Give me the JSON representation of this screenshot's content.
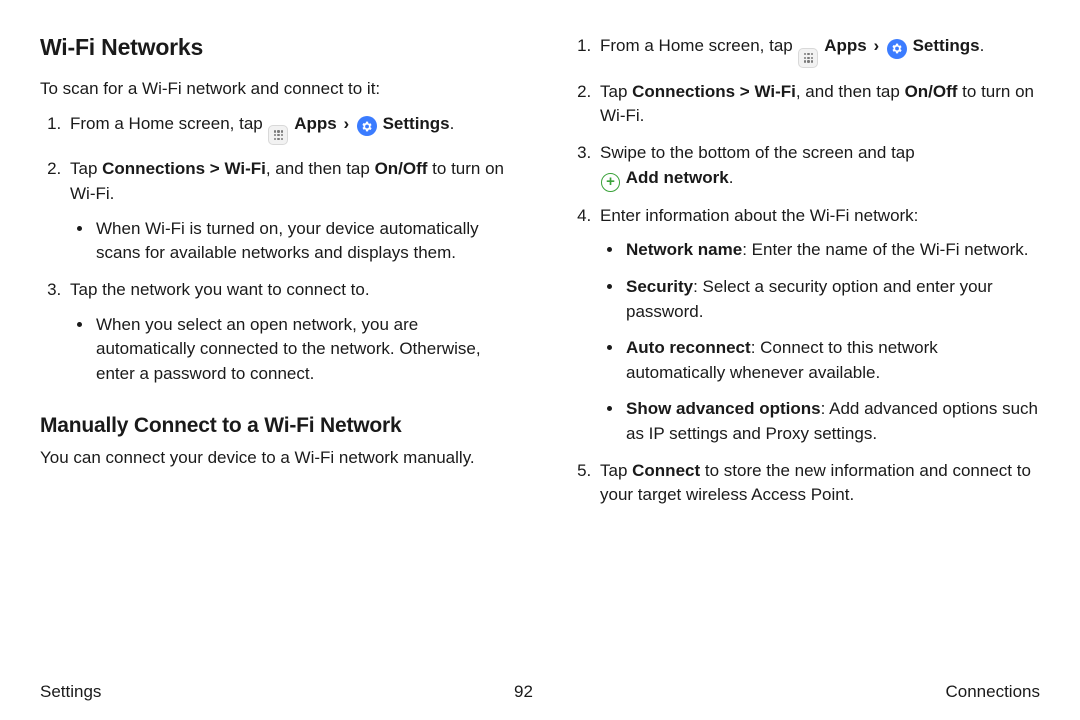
{
  "left": {
    "heading1": "Wi-Fi Networks",
    "lead1": "To scan for a Wi-Fi network and connect to it:",
    "step1_a": "From a Home screen, tap ",
    "apps_label": "Apps",
    "settings_label": "Settings",
    "period": ".",
    "step2_a": "Tap ",
    "step2_path": "Connections > Wi-Fi",
    "step2_b": ", and then tap ",
    "step2_onoff": "On/Off",
    "step2_c": " to turn on Wi-Fi.",
    "step2_bul": "When Wi-Fi is turned on, your device automatically scans for available networks and displays them.",
    "step3": "Tap the network you want to connect to.",
    "step3_bul": "When you select an open network, you are automatically connected to the network. Otherwise, enter a password to connect.",
    "heading2": "Manually Connect to a Wi-Fi Network",
    "lead2": "You can connect your device to a Wi-Fi network manually."
  },
  "right": {
    "step1_a": "From a Home screen, tap ",
    "apps_label": "Apps",
    "settings_label": "Settings",
    "period": ".",
    "step2_a": "Tap ",
    "step2_path": "Connections > Wi-Fi",
    "step2_b": ", and then tap ",
    "step2_onoff": "On/Off",
    "step2_c": " to turn on Wi-Fi.",
    "step3_a": "Swipe to the bottom of the screen and tap ",
    "addnet_label": "Add network",
    "step4": "Enter information about the Wi-Fi network:",
    "b_netname_t": "Network name",
    "b_netname_d": ": Enter the name of the Wi-Fi network.",
    "b_sec_t": "Security",
    "b_sec_d": ": Select a security option and enter your password.",
    "b_auto_t": "Auto reconnect",
    "b_auto_d": ": Connect to this network automatically whenever available.",
    "b_adv_t": "Show advanced options",
    "b_adv_d": ": Add advanced options such as IP settings and Proxy settings.",
    "step5_a": "Tap ",
    "step5_connect": "Connect",
    "step5_b": " to store the new information and connect to your target wireless Access Point."
  },
  "footer": {
    "left": "Settings",
    "page": "92",
    "right": "Connections"
  }
}
